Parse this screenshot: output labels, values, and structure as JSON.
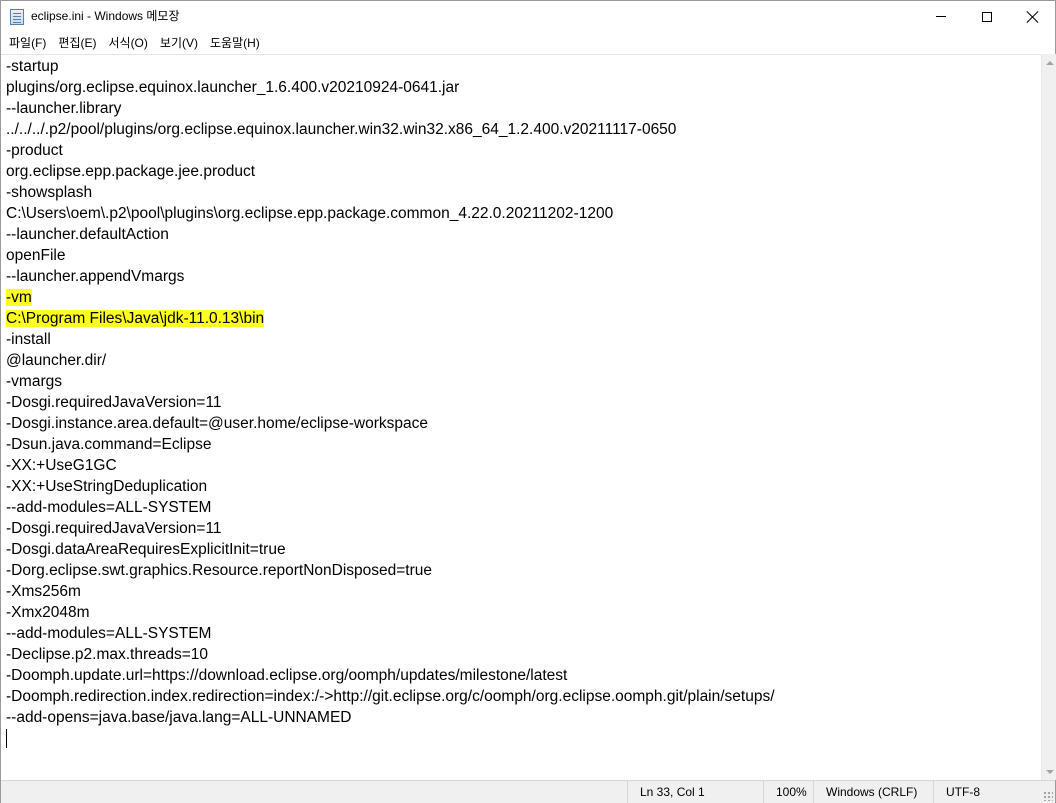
{
  "window": {
    "title": "eclipse.ini - Windows 메모장",
    "icon": "notepad-icon",
    "controls": {
      "minimize_icon": "minimize-icon",
      "maximize_icon": "maximize-icon",
      "close_icon": "close-icon"
    }
  },
  "menu": [
    {
      "label": "파일(F)"
    },
    {
      "label": "편집(E)"
    },
    {
      "label": "서식(O)"
    },
    {
      "label": "보기(V)"
    },
    {
      "label": "도움말(H)"
    }
  ],
  "editor": {
    "highlight_color": "#ffff20",
    "lines": [
      {
        "text": "-startup",
        "highlighted": false
      },
      {
        "text": "plugins/org.eclipse.equinox.launcher_1.6.400.v20210924-0641.jar",
        "highlighted": false
      },
      {
        "text": "--launcher.library",
        "highlighted": false
      },
      {
        "text": "../../../.p2/pool/plugins/org.eclipse.equinox.launcher.win32.win32.x86_64_1.2.400.v20211117-0650",
        "highlighted": false
      },
      {
        "text": "-product",
        "highlighted": false
      },
      {
        "text": "org.eclipse.epp.package.jee.product",
        "highlighted": false
      },
      {
        "text": "-showsplash",
        "highlighted": false
      },
      {
        "text": "C:\\Users\\oem\\.p2\\pool\\plugins\\org.eclipse.epp.package.common_4.22.0.20211202-1200",
        "highlighted": false
      },
      {
        "text": "--launcher.defaultAction",
        "highlighted": false
      },
      {
        "text": "openFile",
        "highlighted": false
      },
      {
        "text": "--launcher.appendVmargs",
        "highlighted": false
      },
      {
        "text": "-vm",
        "highlighted": true
      },
      {
        "text": "C:\\Program Files\\Java\\jdk-11.0.13\\bin",
        "highlighted": true
      },
      {
        "text": "-install",
        "highlighted": false
      },
      {
        "text": "@launcher.dir/",
        "highlighted": false
      },
      {
        "text": "-vmargs",
        "highlighted": false
      },
      {
        "text": "-Dosgi.requiredJavaVersion=11",
        "highlighted": false
      },
      {
        "text": "-Dosgi.instance.area.default=@user.home/eclipse-workspace",
        "highlighted": false
      },
      {
        "text": "-Dsun.java.command=Eclipse",
        "highlighted": false
      },
      {
        "text": "-XX:+UseG1GC",
        "highlighted": false
      },
      {
        "text": "-XX:+UseStringDeduplication",
        "highlighted": false
      },
      {
        "text": "--add-modules=ALL-SYSTEM",
        "highlighted": false
      },
      {
        "text": "-Dosgi.requiredJavaVersion=11",
        "highlighted": false
      },
      {
        "text": "-Dosgi.dataAreaRequiresExplicitInit=true",
        "highlighted": false
      },
      {
        "text": "-Dorg.eclipse.swt.graphics.Resource.reportNonDisposed=true",
        "highlighted": false
      },
      {
        "text": "-Xms256m",
        "highlighted": false
      },
      {
        "text": "-Xmx2048m",
        "highlighted": false
      },
      {
        "text": "--add-modules=ALL-SYSTEM",
        "highlighted": false
      },
      {
        "text": "-Declipse.p2.max.threads=10",
        "highlighted": false
      },
      {
        "text": "-Doomph.update.url=https://download.eclipse.org/oomph/updates/milestone/latest",
        "highlighted": false
      },
      {
        "text": "-Doomph.redirection.index.redirection=index:/->http://git.eclipse.org/c/oomph/org.eclipse.oomph.git/plain/setups/",
        "highlighted": false
      },
      {
        "text": "--add-opens=java.base/java.lang=ALL-UNNAMED",
        "highlighted": false
      },
      {
        "text": "",
        "highlighted": false
      }
    ]
  },
  "statusbar": {
    "position": "Ln 33, Col 1",
    "zoom": "100%",
    "line_ending": "Windows (CRLF)",
    "encoding": "UTF-8"
  }
}
